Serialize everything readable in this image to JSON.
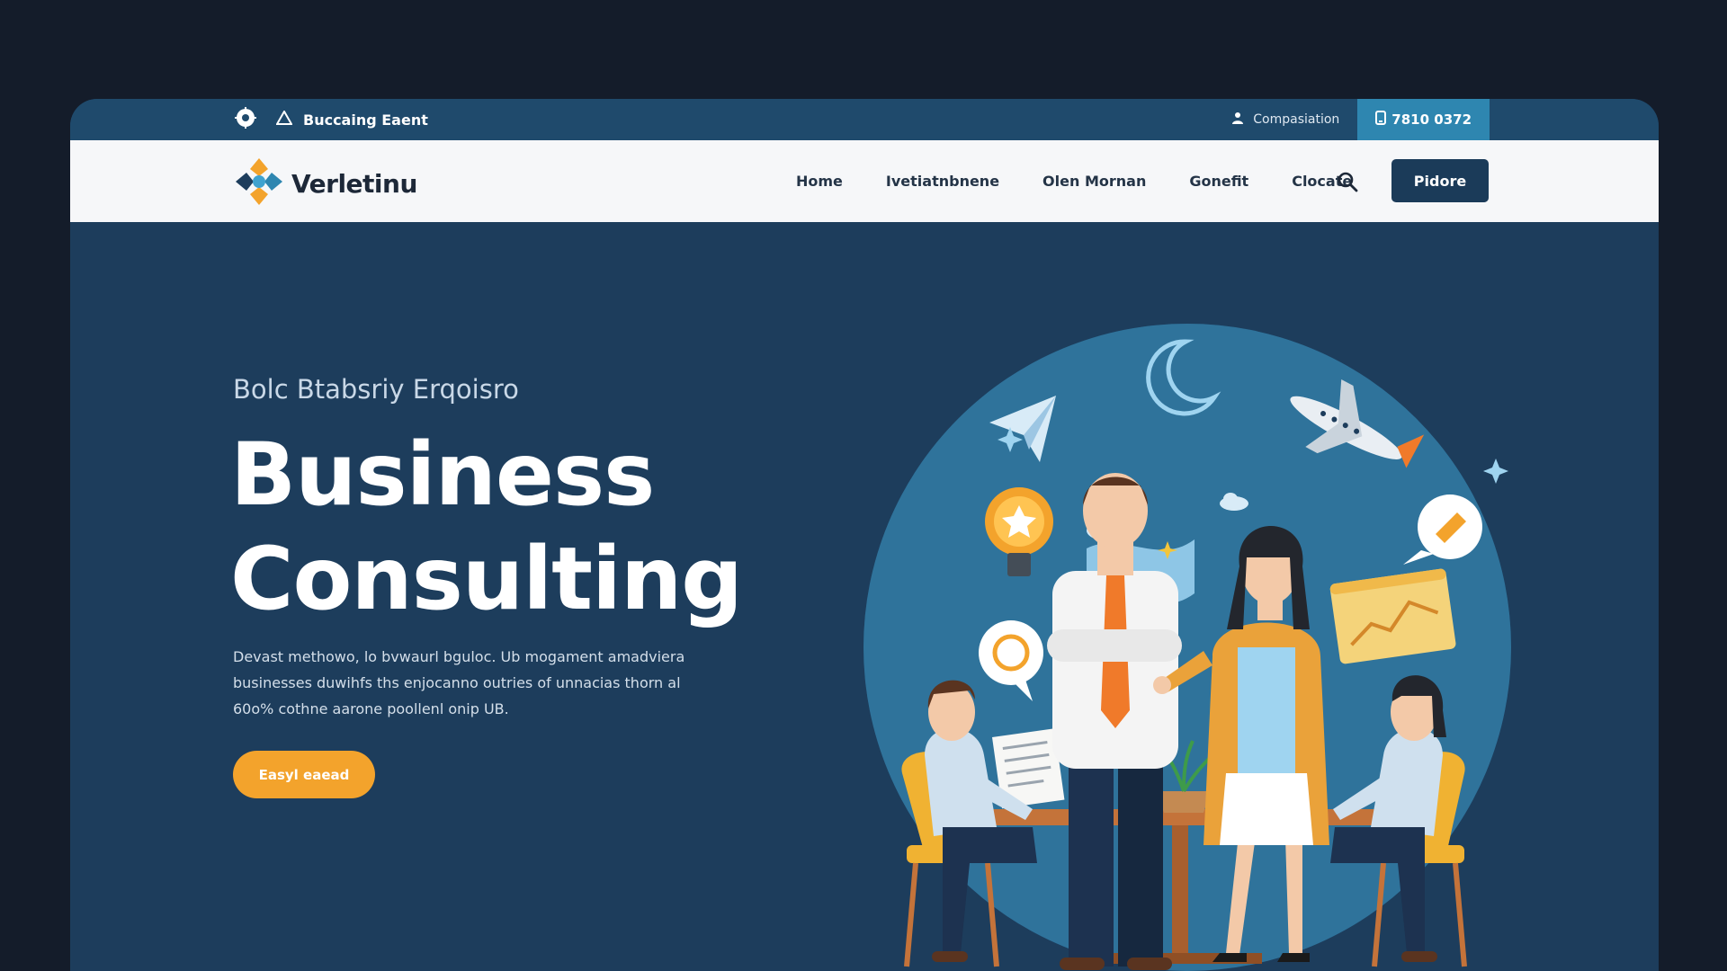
{
  "topbar": {
    "announcement": "Buccaing Eaent",
    "company_label": "Compasiation",
    "phone": "7810 0372"
  },
  "navbar": {
    "brand": "Verletinu",
    "links": [
      "Home",
      "Ivetiatnbnene",
      "Olen Mornan",
      "Gonefit",
      "Clocate"
    ],
    "cta": "Pidore"
  },
  "hero": {
    "eyebrow": "Bolc Btabsriy Erqoisro",
    "headline_line1": "Business",
    "headline_line2": "Consulting",
    "description_lines": [
      "Devast methowo, lo bvwaurl bguloc. Ub mogament amadviera",
      "businesses duwihfs ths enjocanno outries of unnacias thorn al",
      "60o% cothne aarone poollenl onip UB."
    ],
    "cta": "Easyl eaead"
  },
  "colors": {
    "page_bg": "#141c2a",
    "hero_bg": "#1d3d5c",
    "topbar_bg": "#1f4a6c",
    "phone_bg": "#2e86b0",
    "navbar_bg": "#f6f7f9",
    "accent_orange": "#f3a32c",
    "nav_button_bg": "#1b3b59"
  },
  "icons": {
    "topbar_left": [
      "gear-badge-icon",
      "warning-triangle-icon"
    ],
    "company": "user-icon",
    "phone": "phone-icon",
    "search": "search-icon"
  }
}
